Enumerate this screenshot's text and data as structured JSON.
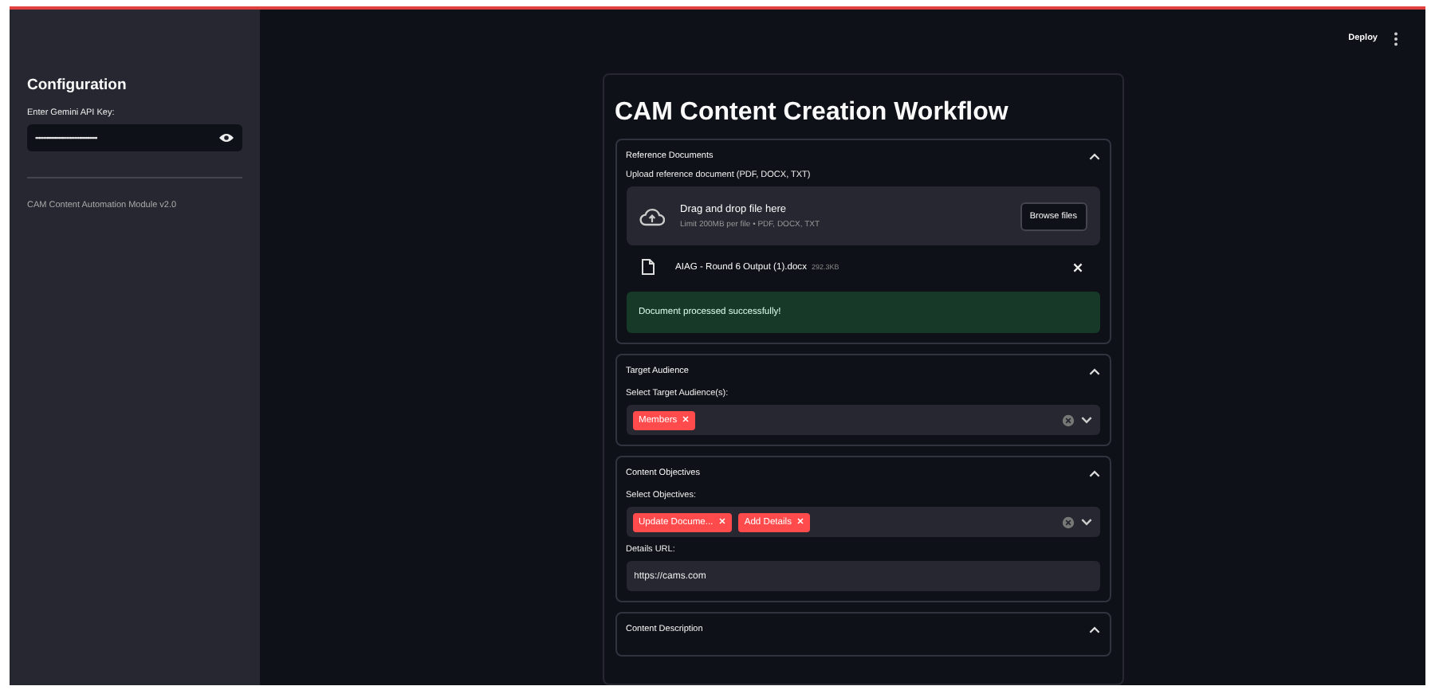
{
  "header": {
    "deploy": "Deploy"
  },
  "sidebar": {
    "title": "Configuration",
    "api_key": {
      "label": "Enter Gemini API Key:",
      "value": "••••••••••••••••••••••••••••••••••••••••"
    },
    "footer": "CAM Content Automation Module v2.0"
  },
  "main": {
    "title": "CAM Content Creation Workflow",
    "reference_documents": {
      "title": "Reference Documents",
      "expanded": true,
      "upload_label": "Upload reference document (PDF, DOCX, TXT)",
      "dropzone": {
        "text": "Drag and drop file here",
        "hint": "Limit 200MB per file • PDF, DOCX, TXT",
        "button": "Browse files"
      },
      "file": {
        "name": "AIAG - Round 6 Output (1).docx",
        "size": "292.3KB"
      },
      "success": "Document processed successfully!"
    },
    "target_audience": {
      "title": "Target Audience",
      "expanded": true,
      "label": "Select Target Audience(s):",
      "tags": [
        "Members"
      ]
    },
    "content_objectives": {
      "title": "Content Objectives",
      "expanded": true,
      "label": "Select Objectives:",
      "tags": [
        "Update Docume...",
        "Add Details"
      ],
      "url_label": "Details URL:",
      "url_value": "https://cams.com"
    },
    "content_description": {
      "title": "Content Description",
      "expanded": true
    }
  }
}
